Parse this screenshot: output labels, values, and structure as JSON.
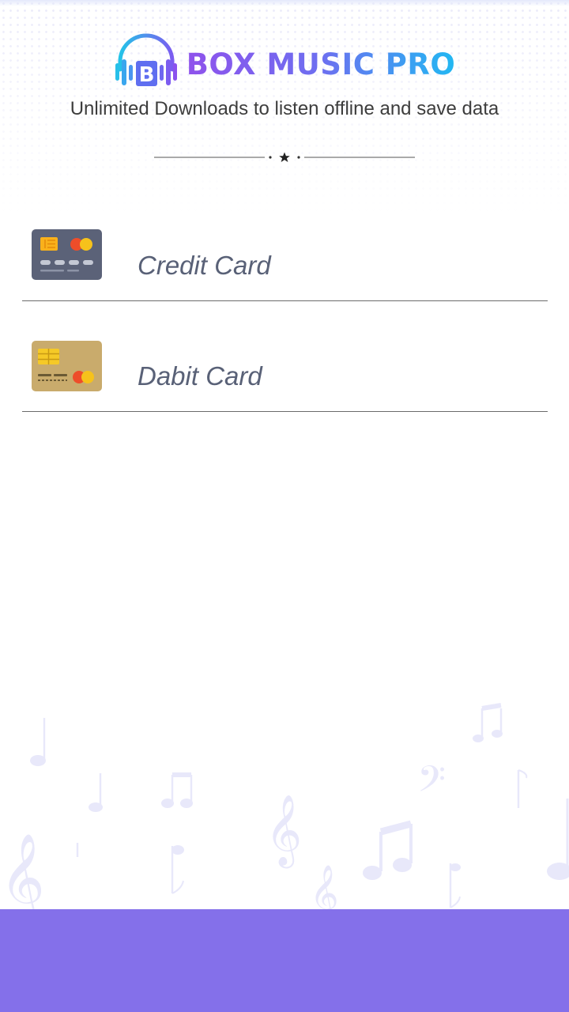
{
  "header": {
    "brand_name": "BOX MUSIC PRO",
    "logo_letter": "B",
    "tagline": "Unlimited Downloads to listen offline and save data"
  },
  "payment_options": [
    {
      "label": "Credit Card",
      "icon": "credit-card-icon"
    },
    {
      "label": "Dabit Card",
      "icon": "debit-card-icon"
    }
  ],
  "colors": {
    "brand_gradient_start": "#8f52ec",
    "brand_gradient_end": "#22b8f2",
    "option_text": "#596177",
    "credit_card": "#5b6278",
    "debit_card": "#c9ab6c",
    "footer": "#8470ea"
  }
}
